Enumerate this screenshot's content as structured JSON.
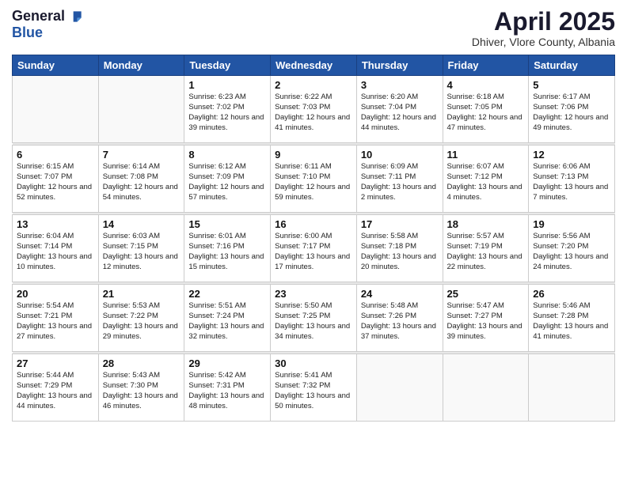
{
  "header": {
    "logo_general": "General",
    "logo_blue": "Blue",
    "month_title": "April 2025",
    "location": "Dhiver, Vlore County, Albania"
  },
  "days_of_week": [
    "Sunday",
    "Monday",
    "Tuesday",
    "Wednesday",
    "Thursday",
    "Friday",
    "Saturday"
  ],
  "weeks": [
    [
      {
        "day": "",
        "info": ""
      },
      {
        "day": "",
        "info": ""
      },
      {
        "day": "1",
        "info": "Sunrise: 6:23 AM\nSunset: 7:02 PM\nDaylight: 12 hours and 39 minutes."
      },
      {
        "day": "2",
        "info": "Sunrise: 6:22 AM\nSunset: 7:03 PM\nDaylight: 12 hours and 41 minutes."
      },
      {
        "day": "3",
        "info": "Sunrise: 6:20 AM\nSunset: 7:04 PM\nDaylight: 12 hours and 44 minutes."
      },
      {
        "day": "4",
        "info": "Sunrise: 6:18 AM\nSunset: 7:05 PM\nDaylight: 12 hours and 47 minutes."
      },
      {
        "day": "5",
        "info": "Sunrise: 6:17 AM\nSunset: 7:06 PM\nDaylight: 12 hours and 49 minutes."
      }
    ],
    [
      {
        "day": "6",
        "info": "Sunrise: 6:15 AM\nSunset: 7:07 PM\nDaylight: 12 hours and 52 minutes."
      },
      {
        "day": "7",
        "info": "Sunrise: 6:14 AM\nSunset: 7:08 PM\nDaylight: 12 hours and 54 minutes."
      },
      {
        "day": "8",
        "info": "Sunrise: 6:12 AM\nSunset: 7:09 PM\nDaylight: 12 hours and 57 minutes."
      },
      {
        "day": "9",
        "info": "Sunrise: 6:11 AM\nSunset: 7:10 PM\nDaylight: 12 hours and 59 minutes."
      },
      {
        "day": "10",
        "info": "Sunrise: 6:09 AM\nSunset: 7:11 PM\nDaylight: 13 hours and 2 minutes."
      },
      {
        "day": "11",
        "info": "Sunrise: 6:07 AM\nSunset: 7:12 PM\nDaylight: 13 hours and 4 minutes."
      },
      {
        "day": "12",
        "info": "Sunrise: 6:06 AM\nSunset: 7:13 PM\nDaylight: 13 hours and 7 minutes."
      }
    ],
    [
      {
        "day": "13",
        "info": "Sunrise: 6:04 AM\nSunset: 7:14 PM\nDaylight: 13 hours and 10 minutes."
      },
      {
        "day": "14",
        "info": "Sunrise: 6:03 AM\nSunset: 7:15 PM\nDaylight: 13 hours and 12 minutes."
      },
      {
        "day": "15",
        "info": "Sunrise: 6:01 AM\nSunset: 7:16 PM\nDaylight: 13 hours and 15 minutes."
      },
      {
        "day": "16",
        "info": "Sunrise: 6:00 AM\nSunset: 7:17 PM\nDaylight: 13 hours and 17 minutes."
      },
      {
        "day": "17",
        "info": "Sunrise: 5:58 AM\nSunset: 7:18 PM\nDaylight: 13 hours and 20 minutes."
      },
      {
        "day": "18",
        "info": "Sunrise: 5:57 AM\nSunset: 7:19 PM\nDaylight: 13 hours and 22 minutes."
      },
      {
        "day": "19",
        "info": "Sunrise: 5:56 AM\nSunset: 7:20 PM\nDaylight: 13 hours and 24 minutes."
      }
    ],
    [
      {
        "day": "20",
        "info": "Sunrise: 5:54 AM\nSunset: 7:21 PM\nDaylight: 13 hours and 27 minutes."
      },
      {
        "day": "21",
        "info": "Sunrise: 5:53 AM\nSunset: 7:22 PM\nDaylight: 13 hours and 29 minutes."
      },
      {
        "day": "22",
        "info": "Sunrise: 5:51 AM\nSunset: 7:24 PM\nDaylight: 13 hours and 32 minutes."
      },
      {
        "day": "23",
        "info": "Sunrise: 5:50 AM\nSunset: 7:25 PM\nDaylight: 13 hours and 34 minutes."
      },
      {
        "day": "24",
        "info": "Sunrise: 5:48 AM\nSunset: 7:26 PM\nDaylight: 13 hours and 37 minutes."
      },
      {
        "day": "25",
        "info": "Sunrise: 5:47 AM\nSunset: 7:27 PM\nDaylight: 13 hours and 39 minutes."
      },
      {
        "day": "26",
        "info": "Sunrise: 5:46 AM\nSunset: 7:28 PM\nDaylight: 13 hours and 41 minutes."
      }
    ],
    [
      {
        "day": "27",
        "info": "Sunrise: 5:44 AM\nSunset: 7:29 PM\nDaylight: 13 hours and 44 minutes."
      },
      {
        "day": "28",
        "info": "Sunrise: 5:43 AM\nSunset: 7:30 PM\nDaylight: 13 hours and 46 minutes."
      },
      {
        "day": "29",
        "info": "Sunrise: 5:42 AM\nSunset: 7:31 PM\nDaylight: 13 hours and 48 minutes."
      },
      {
        "day": "30",
        "info": "Sunrise: 5:41 AM\nSunset: 7:32 PM\nDaylight: 13 hours and 50 minutes."
      },
      {
        "day": "",
        "info": ""
      },
      {
        "day": "",
        "info": ""
      },
      {
        "day": "",
        "info": ""
      }
    ]
  ]
}
